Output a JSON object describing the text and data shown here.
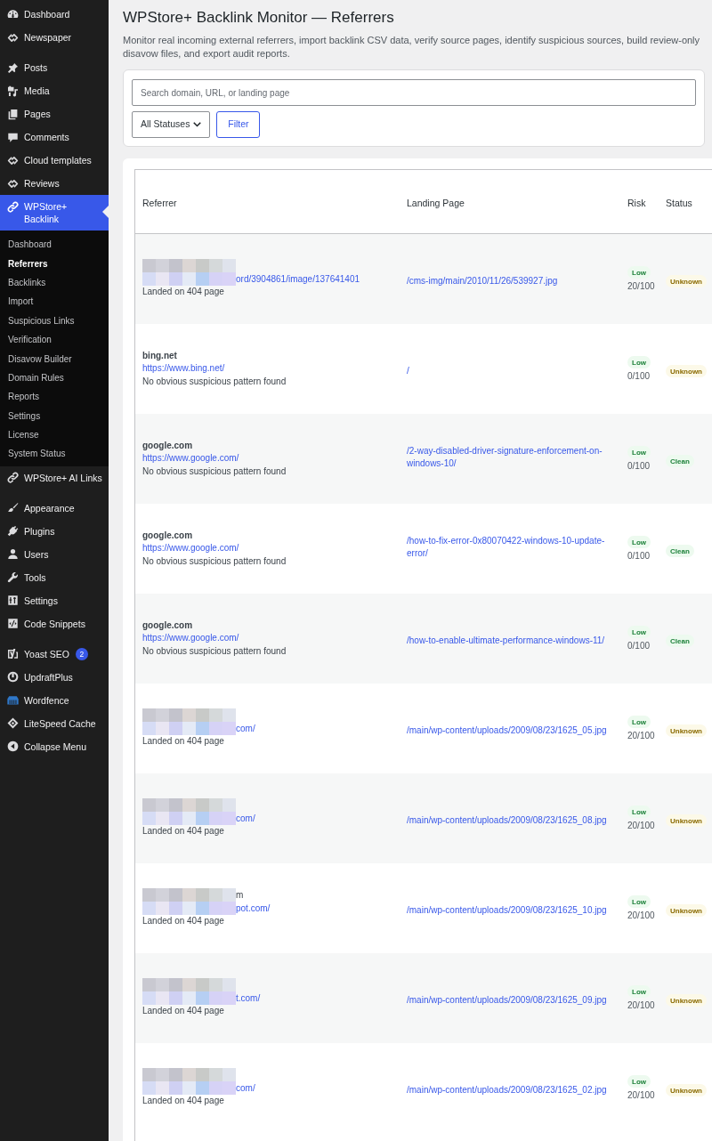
{
  "sidebar": {
    "groups": [
      {
        "items": [
          {
            "label": "Dashboard",
            "selected": false
          },
          {
            "label": "Newspaper",
            "selected": false
          }
        ]
      },
      {
        "items": [
          {
            "label": "Posts",
            "selected": false
          },
          {
            "label": "Media",
            "selected": false
          },
          {
            "label": "Pages",
            "selected": false
          },
          {
            "label": "Comments",
            "selected": false
          },
          {
            "label": "Cloud templates",
            "selected": false
          },
          {
            "label": "Reviews",
            "selected": false
          },
          {
            "label": "WPStore+ Backlink",
            "selected": true,
            "children": [
              {
                "label": "Dashboard",
                "selected": false
              },
              {
                "label": "Referrers",
                "selected": true
              },
              {
                "label": "Backlinks",
                "selected": false
              },
              {
                "label": "Import",
                "selected": false
              },
              {
                "label": "Suspicious Links",
                "selected": false
              },
              {
                "label": "Verification",
                "selected": false
              },
              {
                "label": "Disavow Builder",
                "selected": false
              },
              {
                "label": "Domain Rules",
                "selected": false
              },
              {
                "label": "Reports",
                "selected": false
              },
              {
                "label": "Settings",
                "selected": false
              },
              {
                "label": "License",
                "selected": false
              },
              {
                "label": "System Status",
                "selected": false
              }
            ]
          },
          {
            "label": "WPStore+ AI Links",
            "selected": false
          }
        ]
      },
      {
        "items": [
          {
            "label": "Appearance",
            "selected": false
          },
          {
            "label": "Plugins",
            "selected": false
          },
          {
            "label": "Users",
            "selected": false
          },
          {
            "label": "Tools",
            "selected": false
          },
          {
            "label": "Settings",
            "selected": false
          },
          {
            "label": "Code Snippets",
            "selected": false
          }
        ]
      },
      {
        "items": [
          {
            "label": "Yoast SEO",
            "selected": false,
            "badge": "2"
          },
          {
            "label": "UpdraftPlus",
            "selected": false
          },
          {
            "label": "Wordfence",
            "selected": false
          },
          {
            "label": "LiteSpeed Cache",
            "selected": false
          },
          {
            "label": "Collapse Menu",
            "selected": false
          }
        ]
      }
    ]
  },
  "page": {
    "title": "WPStore+ Backlink Monitor — Referrers",
    "description": "Monitor real incoming external referrers, import backlink CSV data, verify source pages, identify suspicious sources, build review-only disavow files, and export audit reports."
  },
  "filters": {
    "search": {
      "placeholder": "Search domain, URL, or landing page"
    },
    "status_select": {
      "value": "All Statuses"
    },
    "filter_button": "Filter"
  },
  "table": {
    "columns": [
      "Referrer",
      "Landing Page",
      "Risk",
      "Status"
    ],
    "rows": [
      {
        "redacted": true,
        "url_tail": "ord/3904861/image/137641401",
        "note": "Landed on 404 page",
        "landing_page": "/cms-img/main/2010/11/26/539927.jpg",
        "risk": {
          "label": "Low",
          "kind": "low",
          "score": "20/100"
        },
        "status": {
          "label": "Unknown",
          "kind": "unknown"
        }
      },
      {
        "redacted": false,
        "domain": "bing.net",
        "url": "https://www.bing.net/",
        "note": "No obvious suspicious pattern found",
        "landing_page": "/",
        "risk": {
          "label": "Low",
          "kind": "low",
          "score": "0/100"
        },
        "status": {
          "label": "Unknown",
          "kind": "unknown"
        }
      },
      {
        "redacted": false,
        "domain": "google.com",
        "url": "https://www.google.com/",
        "note": "No obvious suspicious pattern found",
        "landing_page": "/2-way-disabled-driver-signature-enforcement-on-windows-10/",
        "risk": {
          "label": "Low",
          "kind": "low",
          "score": "0/100"
        },
        "status": {
          "label": "Clean",
          "kind": "clean"
        }
      },
      {
        "redacted": false,
        "domain": "google.com",
        "url": "https://www.google.com/",
        "note": "No obvious suspicious pattern found",
        "landing_page": "/how-to-fix-error-0x80070422-windows-10-update-error/",
        "risk": {
          "label": "Low",
          "kind": "low",
          "score": "0/100"
        },
        "status": {
          "label": "Clean",
          "kind": "clean"
        }
      },
      {
        "redacted": false,
        "domain": "google.com",
        "url": "https://www.google.com/",
        "note": "No obvious suspicious pattern found",
        "landing_page": "/how-to-enable-ultimate-performance-windows-11/",
        "risk": {
          "label": "Low",
          "kind": "low",
          "score": "0/100"
        },
        "status": {
          "label": "Clean",
          "kind": "clean"
        }
      },
      {
        "redacted": true,
        "url_tail": "com/",
        "note": "Landed on 404 page",
        "landing_page": "/main/wp-content/uploads/2009/08/23/1625_05.jpg",
        "risk": {
          "label": "Low",
          "kind": "low",
          "score": "20/100"
        },
        "status": {
          "label": "Unknown",
          "kind": "unknown"
        }
      },
      {
        "redacted": true,
        "url_tail": "com/",
        "note": "Landed on 404 page",
        "landing_page": "/main/wp-content/uploads/2009/08/23/1625_08.jpg",
        "risk": {
          "label": "Low",
          "kind": "low",
          "score": "20/100"
        },
        "status": {
          "label": "Unknown",
          "kind": "unknown"
        }
      },
      {
        "redacted": true,
        "domain_tail": "m",
        "url_tail": "pot.com/",
        "note": "Landed on 404 page",
        "landing_page": "/main/wp-content/uploads/2009/08/23/1625_10.jpg",
        "risk": {
          "label": "Low",
          "kind": "low",
          "score": "20/100"
        },
        "status": {
          "label": "Unknown",
          "kind": "unknown"
        }
      },
      {
        "redacted": true,
        "url_tail": "t.com/",
        "note": "Landed on 404 page",
        "landing_page": "/main/wp-content/uploads/2009/08/23/1625_09.jpg",
        "risk": {
          "label": "Low",
          "kind": "low",
          "score": "20/100"
        },
        "status": {
          "label": "Unknown",
          "kind": "unknown"
        }
      },
      {
        "redacted": true,
        "url_tail": "com/",
        "note": "Landed on 404 page",
        "landing_page": "/main/wp-content/uploads/2009/08/23/1625_02.jpg",
        "risk": {
          "label": "Low",
          "kind": "low",
          "score": "20/100"
        },
        "status": {
          "label": "Unknown",
          "kind": "unknown"
        }
      }
    ]
  }
}
